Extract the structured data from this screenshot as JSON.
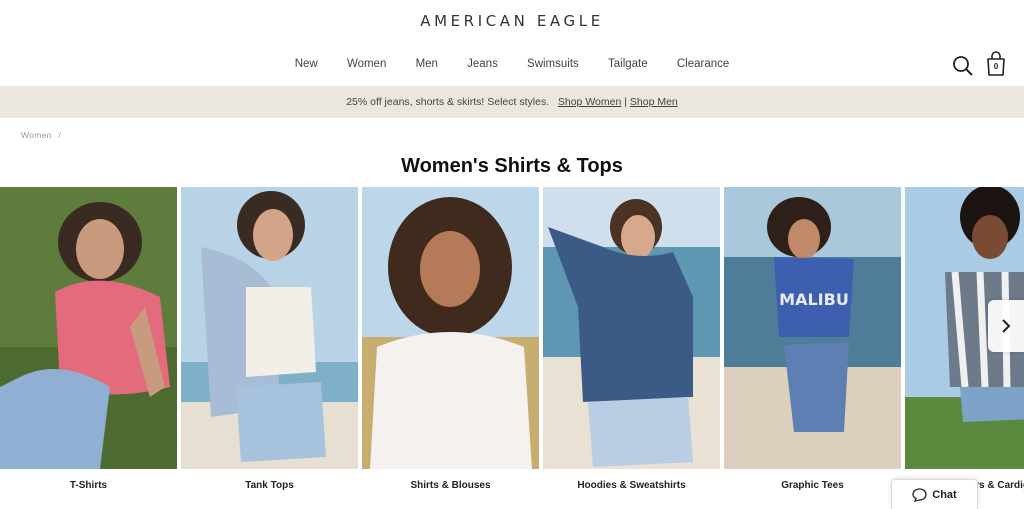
{
  "header": {
    "logo": "AMERICAN EAGLE",
    "nav": [
      "New",
      "Women",
      "Men",
      "Jeans",
      "Swimsuits",
      "Tailgate",
      "Clearance"
    ],
    "bag_count": "0",
    "icons": {
      "search": "search-icon",
      "bag": "shopping-bag-icon"
    }
  },
  "promo": {
    "text": "25% off jeans, shorts & skirts! Select styles.",
    "link_women": "Shop Women",
    "divider": "|",
    "link_men": "Shop Men"
  },
  "breadcrumb": {
    "item": "Women",
    "separator": "/"
  },
  "page_title": "Women's Shirts & Tops",
  "categories": [
    {
      "label": "T-Shirts"
    },
    {
      "label": "Tank Tops"
    },
    {
      "label": "Shirts & Blouses"
    },
    {
      "label": "Hoodies & Sweatshirts"
    },
    {
      "label": "Graphic Tees"
    },
    {
      "label": "Sweaters & Cardigans"
    }
  ],
  "graphic_text": "MALIBU",
  "chat": {
    "label": "Chat",
    "icon": "chat-bubble-icon"
  },
  "carousel": {
    "next_icon": "chevron-right-icon"
  },
  "colors": {
    "promo_bg": "#ece7de",
    "accent": "#111111"
  }
}
